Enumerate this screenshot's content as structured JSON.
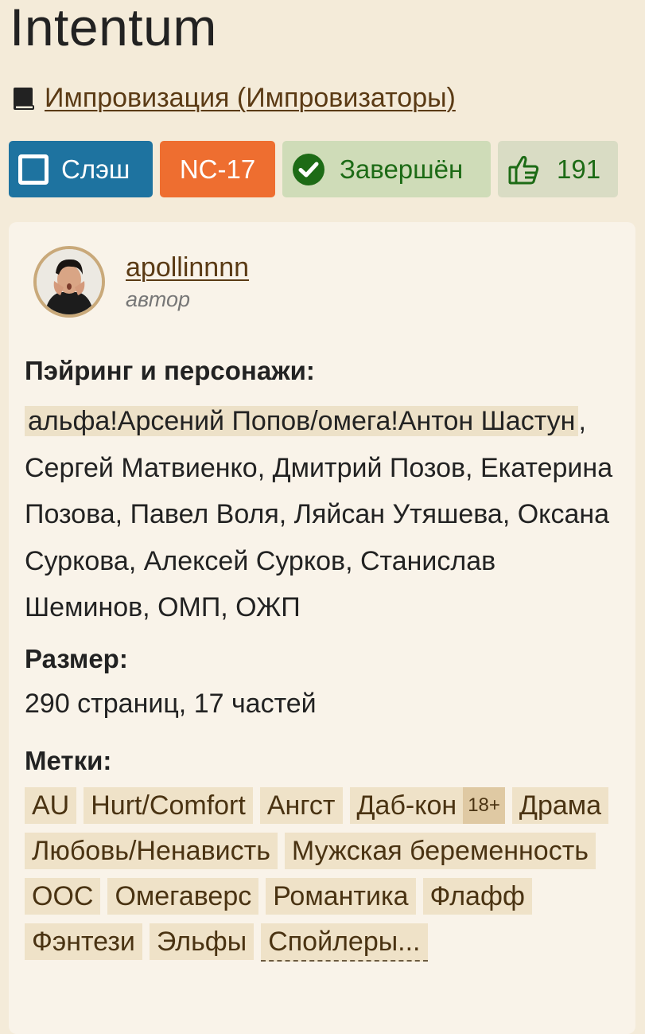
{
  "title": "Intentum",
  "fandom": {
    "icon": "book-icon",
    "link": "Импровизация (Импровизаторы)"
  },
  "badges": {
    "direction": "Слэш",
    "rating": "NC-17",
    "status": "Завершён",
    "likes": "191",
    "colors": {
      "direction": "#1e73a0",
      "rating": "#ee6e30",
      "status_bg": "#cfdcb8",
      "likes_bg": "#d9dcc4"
    }
  },
  "author": {
    "name": "apollinnnn",
    "role": "автор"
  },
  "pairing": {
    "label": "Пэйринг и персонажи:",
    "main_pair": "альфа!Арсений Попов/омега!Антон Шастун",
    "others": ", Сергей Матвиенко, Дмитрий Позов, Екатерина Позова, Павел Воля, Ляйсан Утяшева, Оксана Суркова, Алексей Сурков, Станислав Шеминов, ОМП, ОЖП"
  },
  "size": {
    "label": "Размер:",
    "value": "290 страниц, 17 частей"
  },
  "tags": {
    "label": "Метки:",
    "items": [
      {
        "text": "AU"
      },
      {
        "text": "Hurt/Comfort"
      },
      {
        "text": "Ангст"
      },
      {
        "text": "Даб-кон",
        "age": "18+"
      },
      {
        "text": "Драма"
      },
      {
        "text": "Любовь/Ненависть"
      },
      {
        "text": "Мужская беременность"
      },
      {
        "text": "ООС"
      },
      {
        "text": "Омегаверс"
      },
      {
        "text": "Романтика"
      },
      {
        "text": "Флафф"
      },
      {
        "text": "Фэнтези"
      },
      {
        "text": "Эльфы"
      }
    ],
    "spoilers": "Спойлеры..."
  }
}
